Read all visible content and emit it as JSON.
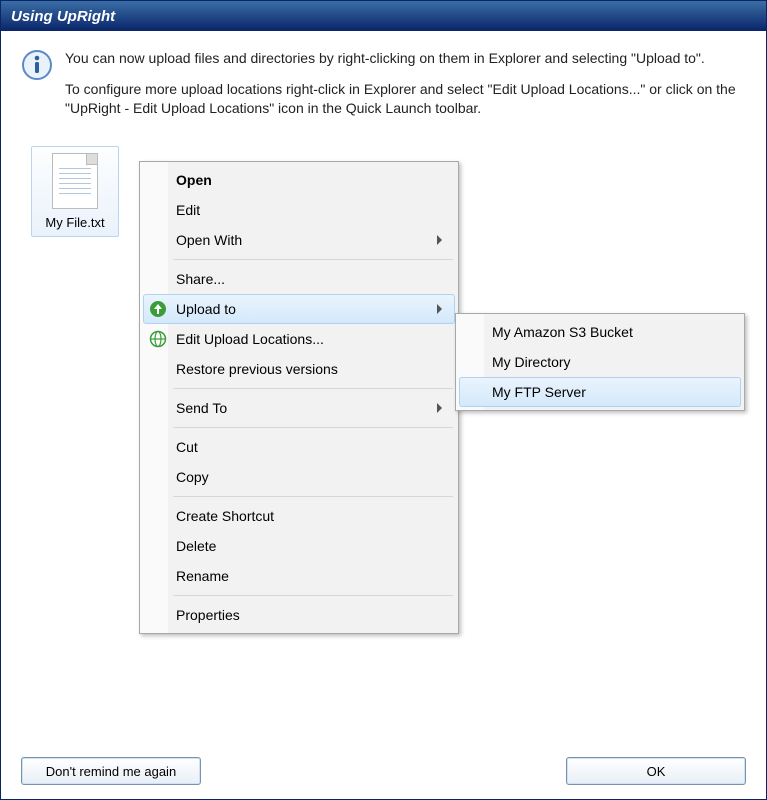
{
  "window": {
    "title": "Using UpRight"
  },
  "info": {
    "para1": "You can now upload files and directories by right-clicking on them in Explorer and selecting \"Upload to\".",
    "para2": "To configure more upload locations right-click in Explorer and select \"Edit Upload Locations...\" or click on the \"UpRight - Edit Upload Locations\" icon in the Quick Launch toolbar."
  },
  "file": {
    "name": "My File.txt"
  },
  "contextMenu": {
    "open": "Open",
    "edit": "Edit",
    "openWith": "Open With",
    "share": "Share...",
    "uploadTo": "Upload to",
    "editUploadLocations": "Edit Upload Locations...",
    "restorePrevious": "Restore previous versions",
    "sendTo": "Send To",
    "cut": "Cut",
    "copy": "Copy",
    "createShortcut": "Create Shortcut",
    "delete": "Delete",
    "rename": "Rename",
    "properties": "Properties"
  },
  "submenu": {
    "s3": "My Amazon S3 Bucket",
    "directory": "My Directory",
    "ftp": "My FTP Server"
  },
  "buttons": {
    "dontRemind": "Don't remind me again",
    "ok": "OK"
  }
}
